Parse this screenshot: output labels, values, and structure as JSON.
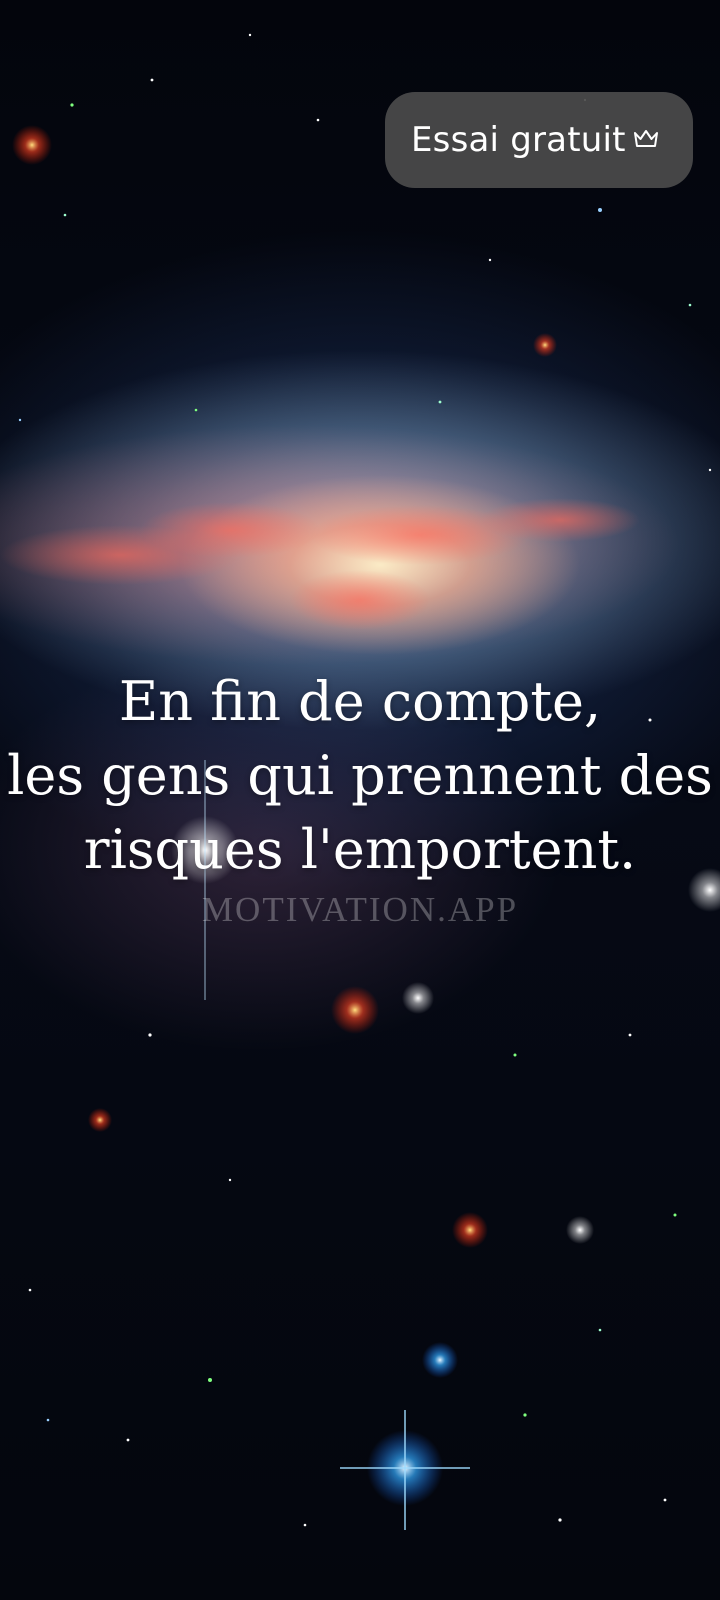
{
  "trial_button": {
    "label": "Essai gratuit",
    "icon": "crown-icon"
  },
  "quote": {
    "lines": [
      "En fin de compte,",
      "les gens qui prennent des",
      "risques l'emportent."
    ]
  },
  "watermark": "MOTIVATION.APP",
  "colors": {
    "button_background": "#4b4b4b",
    "text": "#ffffff",
    "sky": "#03050c"
  }
}
